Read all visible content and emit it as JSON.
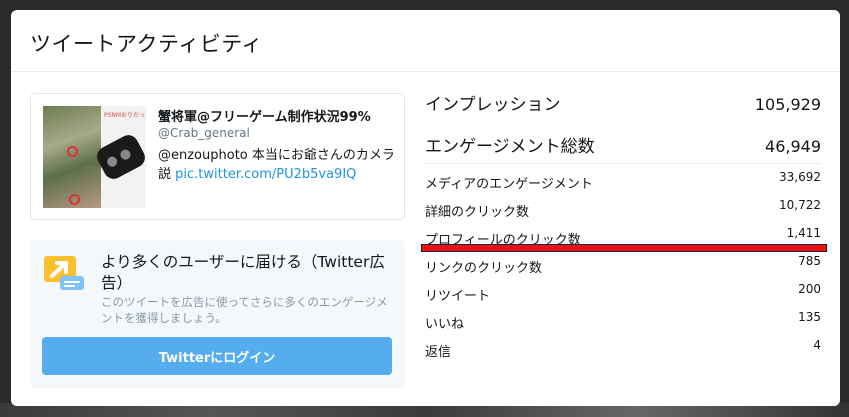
{
  "modal": {
    "title": "ツイートアクティビティ"
  },
  "tweet": {
    "author_name": "蟹将軍@フリーゲーム制作状況99%",
    "handle": "@Crab_general",
    "text": "@enzouphoto 本当にお爺さんのカメラ説 ",
    "link": "pic.twitter.com/PU2b5va9IQ",
    "media_watermark": "PSNMおりだっ"
  },
  "promo": {
    "title": "より多くのユーザーに届ける（Twitter広告）",
    "description": "このツイートを広告に使ってさらに多くのエンゲージメントを獲得しましょう。",
    "button_label": "Twitterにログイン",
    "icon": "promote-arrow-icon"
  },
  "metrics": {
    "primary": [
      {
        "label": "インプレッション",
        "value": "105,929"
      },
      {
        "label": "エンゲージメント総数",
        "value": "46,949"
      }
    ],
    "details": [
      {
        "label": "メディアのエンゲージメント",
        "value": "33,692"
      },
      {
        "label": "詳細のクリック数",
        "value": "10,722"
      },
      {
        "label": "プロフィールのクリック数",
        "value": "1,411"
      },
      {
        "label": "リンクのクリック数",
        "value": "785"
      },
      {
        "label": "リツイート",
        "value": "200"
      },
      {
        "label": "いいね",
        "value": "135"
      },
      {
        "label": "返信",
        "value": "4"
      }
    ]
  },
  "colors": {
    "accent": "#55acee",
    "link": "#1b95e0",
    "highlight": "#e8101a"
  }
}
